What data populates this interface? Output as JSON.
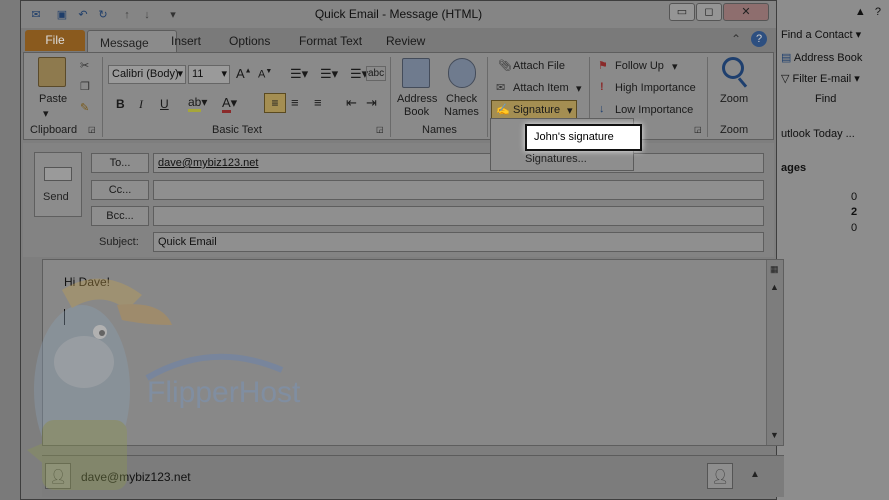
{
  "window": {
    "title": "Quick Email - Message (HTML)"
  },
  "tabs": {
    "file": "File",
    "message": "Message",
    "insert": "Insert",
    "options": "Options",
    "format_text": "Format Text",
    "review": "Review"
  },
  "ribbon": {
    "clipboard": {
      "paste": "Paste",
      "group": "Clipboard"
    },
    "basic_text": {
      "font": "Calibri (Body)",
      "size": "11",
      "group": "Basic Text"
    },
    "names": {
      "address_book_1": "Address",
      "address_book_2": "Book",
      "check_names_1": "Check",
      "check_names_2": "Names",
      "group": "Names"
    },
    "include": {
      "attach_file": "Attach File",
      "attach_item": "Attach Item",
      "signature": "Signature"
    },
    "tags": {
      "follow_up": "Follow Up",
      "high_importance": "High Importance",
      "low_importance": "Low Importance"
    },
    "zoom": {
      "zoom": "Zoom",
      "group": "Zoom"
    }
  },
  "signature_menu": {
    "johns_signature": "John's signature",
    "signatures": "Signatures..."
  },
  "header": {
    "send": "Send",
    "to_label": "To...",
    "to_value": "dave@mybiz123.net",
    "cc_label": "Cc...",
    "cc_value": "",
    "bcc_label": "Bcc...",
    "bcc_value": "",
    "subject_label": "Subject:",
    "subject_value": "Quick Email"
  },
  "body": {
    "greeting": "Hi Dave!"
  },
  "people_pane": {
    "email": "dave@mybiz123.net"
  },
  "background": {
    "find_contact": "Find a Contact",
    "address_book": "Address Book",
    "filter_email": "Filter E-mail",
    "find_group": "Find",
    "outlook_today": "utlook Today ...",
    "messages": "ages",
    "counts": [
      "0",
      "2",
      "0"
    ]
  },
  "watermark": {
    "brand": "FlipperHost"
  }
}
